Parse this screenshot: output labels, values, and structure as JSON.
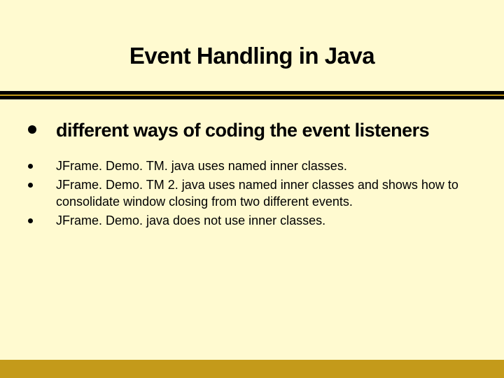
{
  "slide": {
    "title": "Event Handling in Java",
    "main_point": "different ways of coding the event listeners",
    "sub_points": [
      "JFrame. Demo. TM. java uses named inner classes.",
      "JFrame. Demo. TM 2. java uses named inner classes and shows how to consolidate window closing from two different events.",
      "JFrame. Demo. java does not use inner classes."
    ]
  },
  "colors": {
    "background": "#c49a1a",
    "panel": "#fffad0",
    "divider": "#000000"
  }
}
